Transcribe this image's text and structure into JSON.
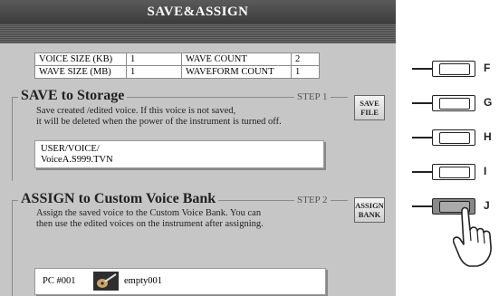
{
  "title": "SAVE&ASSIGN",
  "info_table": {
    "voice_size_label": "VOICE SIZE (KB)",
    "voice_size_value": "1",
    "wave_count_label": "WAVE COUNT",
    "wave_count_value": "2",
    "wave_size_label": "WAVE SIZE (MB)",
    "wave_size_value": "1",
    "waveform_count_label": "WAVEFORM COUNT",
    "waveform_count_value": "1"
  },
  "save_section": {
    "title": "SAVE to Storage",
    "step": "STEP 1",
    "description_line1": "Save created /edited voice. If this voice is not saved,",
    "description_line2": "it will be deleted when the power of the instrument is turned off.",
    "button_line1": "SAVE",
    "button_line2": "FILE",
    "path_line1": "USER/VOICE/",
    "path_line2": "VoiceA.S999.TVN"
  },
  "assign_section": {
    "title": "ASSIGN to Custom Voice Bank",
    "step": "STEP 2",
    "description_line1": "Assign the saved voice to the Custom Voice Bank. You can",
    "description_line2": "then use the edited voices on the instrument after assigning.",
    "button_line1": "ASSIGN",
    "button_line2": "BANK",
    "voice_pc": "PC  #001",
    "voice_name": "empty001"
  },
  "hardware_buttons": [
    "F",
    "G",
    "H",
    "I",
    "J"
  ],
  "pressed_button": "J"
}
